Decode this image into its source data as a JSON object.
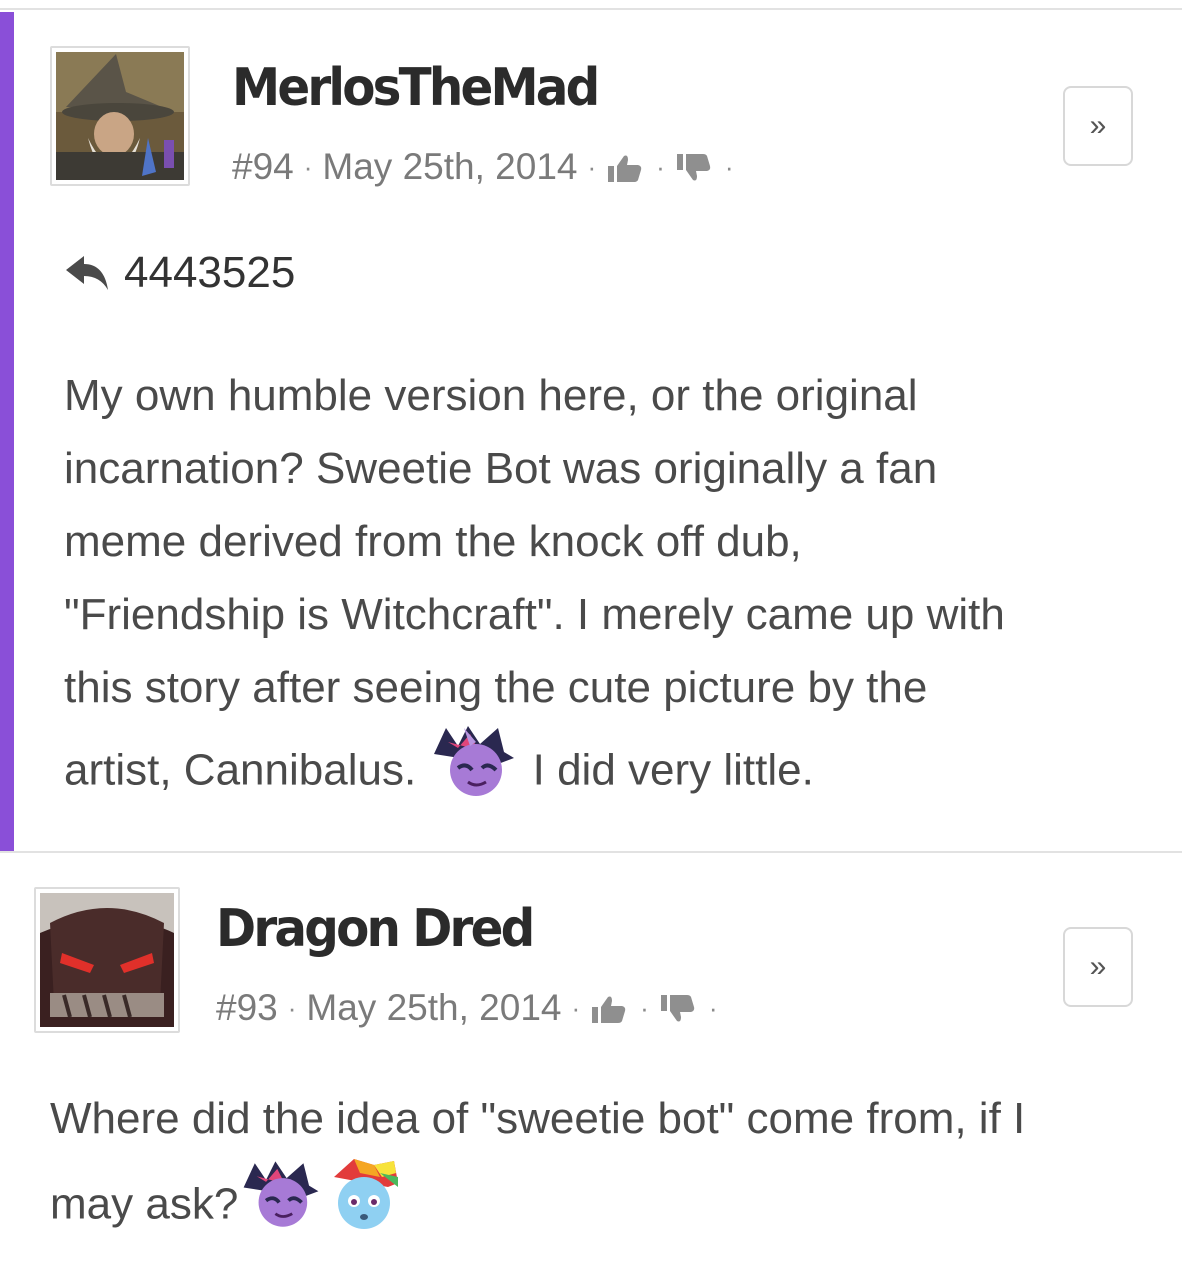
{
  "comments": [
    {
      "username": "MerlosTheMad",
      "number": "#94",
      "date": "May 25th, 2014",
      "sep": "·",
      "expand_label": "»",
      "avatar_icon": "wizard-avatar",
      "accent_color": "#8a4fd8",
      "reply_to": "4443525",
      "body": {
        "line1": "My own humble version here, or the original",
        "line2": "incarnation? Sweetie Bot was originally a fan",
        "line3": "meme derived from the knock off dub,",
        "line4": "\"Friendship is Witchcraft\". I merely came up with",
        "line5": "this story after seeing the cute picture by the",
        "line6a": "artist, Cannibalus.",
        "line6b": "I did very little."
      },
      "emotes": [
        "twilight-sparkle-emote"
      ]
    },
    {
      "username": "Dragon Dred",
      "number": "#93",
      "date": "May 25th, 2014",
      "sep": "·",
      "expand_label": "»",
      "avatar_icon": "robot-avatar",
      "body": {
        "line1": "Where did the idea of \"sweetie bot\" come from, if I",
        "line2": "may ask?"
      },
      "emotes": [
        "twilight-sparkle-emote",
        "rainbow-dash-emote"
      ]
    }
  ],
  "colors": {
    "accent": "#8a4fd8",
    "text": "#4a4a4a",
    "meta": "#7a7a7a",
    "divider": "#e2e2e2"
  }
}
